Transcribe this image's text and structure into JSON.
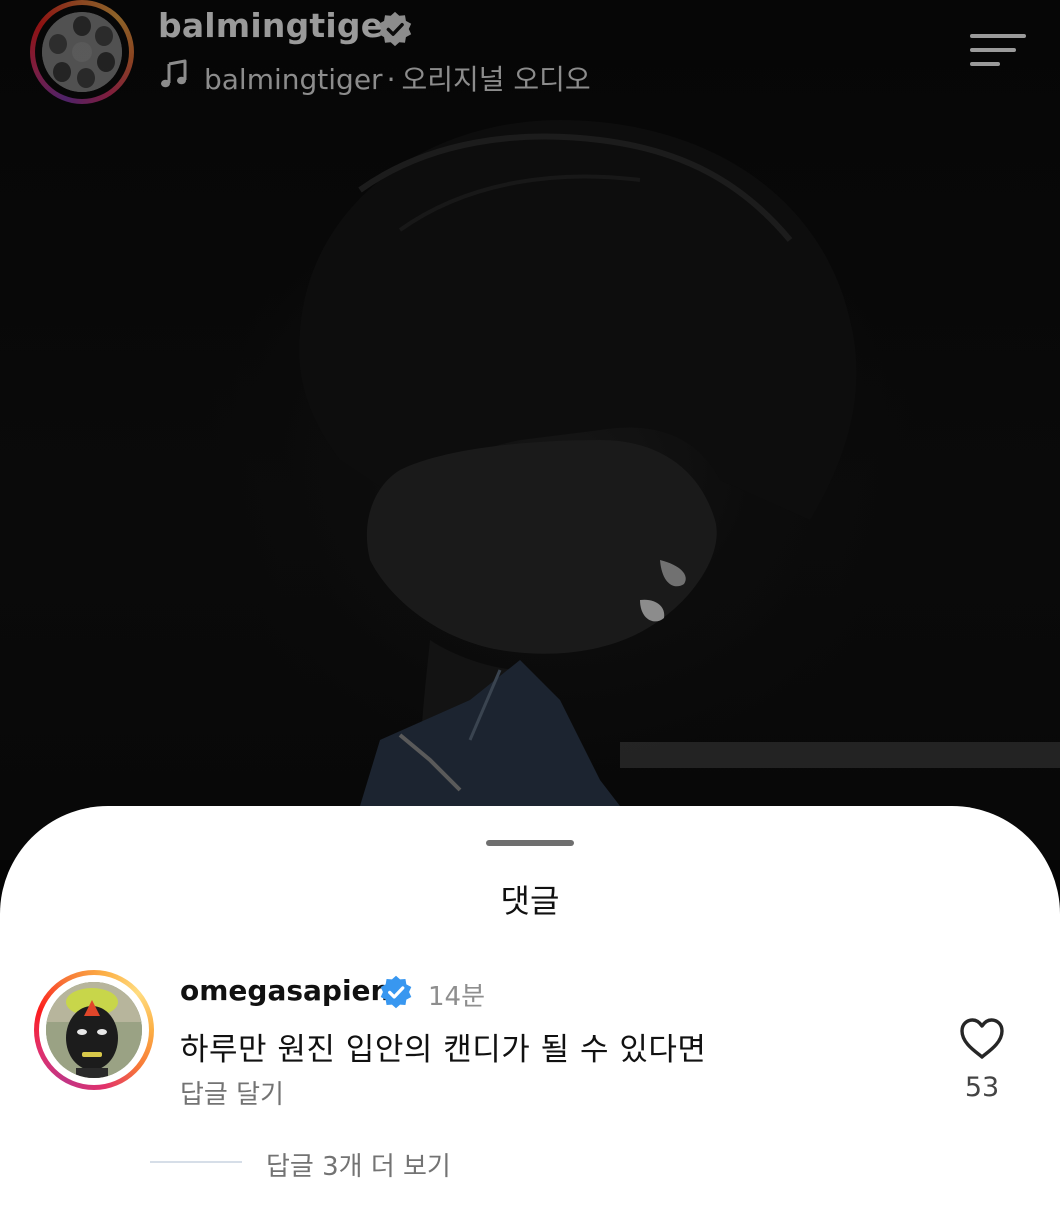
{
  "header": {
    "account_name": "balmingtiger",
    "audio_artist": "balmingtiger",
    "audio_separator": "·",
    "audio_title": "오리지널 오디오",
    "icons": {
      "verified": "verified-badge-icon",
      "music": "music-note-icon",
      "menu": "menu-icon"
    }
  },
  "comments_sheet": {
    "title": "댓글",
    "comments": [
      {
        "username": "omegasapien",
        "time": "14분",
        "text": "하루만 원진 입안의 캔디가 될 수 있다면",
        "reply_label": "답글 달기",
        "like_count": "53",
        "view_replies_label": "답글 3개 더 보기"
      }
    ]
  },
  "colors": {
    "verified_blue": "#3897f0",
    "sheet_background": "#ffffff",
    "video_background": "#050505"
  }
}
